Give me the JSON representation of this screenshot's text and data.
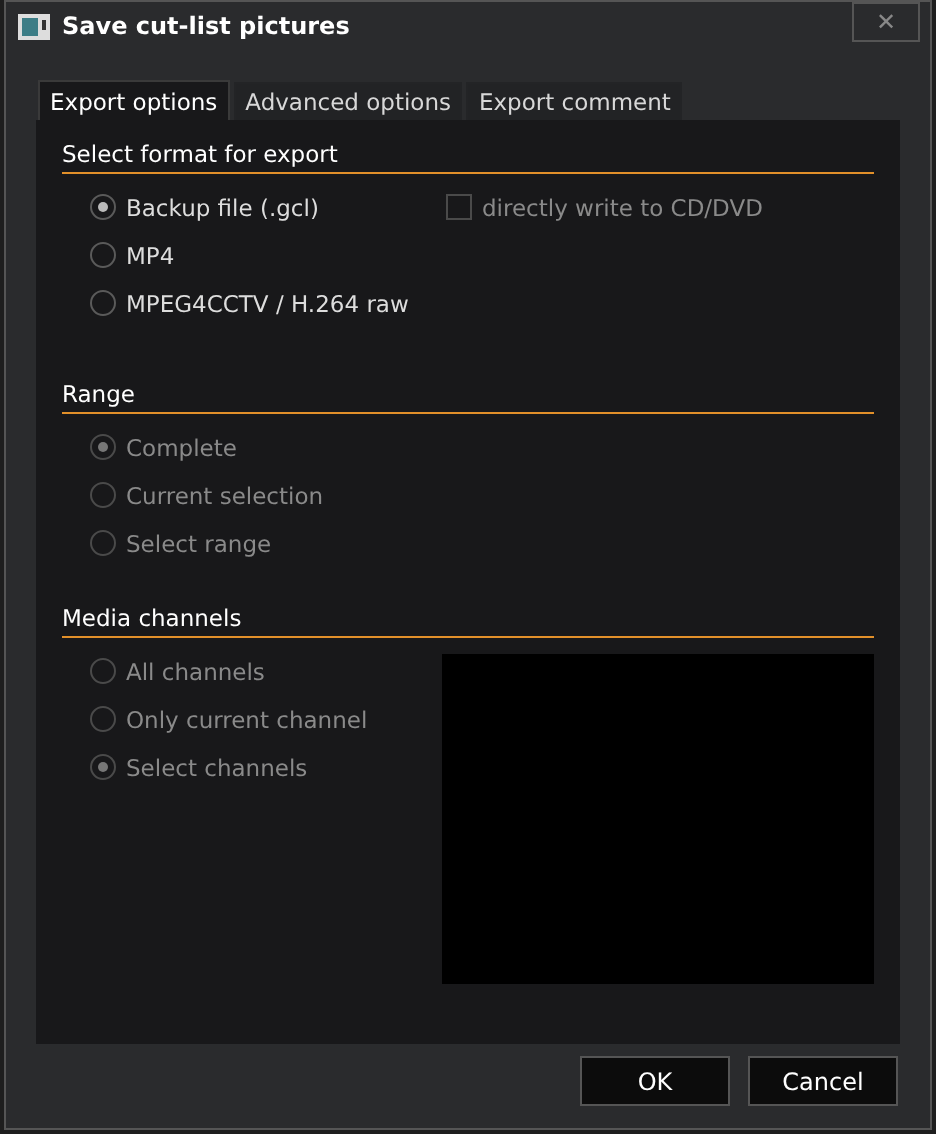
{
  "window": {
    "title": "Save cut-list pictures",
    "close": "✕"
  },
  "tabs": [
    {
      "label": "Export options",
      "selected": true
    },
    {
      "label": "Advanced options",
      "selected": false
    },
    {
      "label": "Export comment",
      "selected": false
    }
  ],
  "sections": [
    {
      "title": "Select format for export",
      "options": [
        {
          "label": "Backup file (.gcl)",
          "selected": true,
          "disabled": false
        },
        {
          "label": "MP4",
          "selected": false,
          "disabled": false
        },
        {
          "label": "MPEG4CCTV / H.264 raw",
          "selected": false,
          "disabled": false
        }
      ],
      "checkbox": {
        "label": "directly write to CD/DVD",
        "checked": false,
        "disabled": true
      }
    },
    {
      "title": "Range",
      "options": [
        {
          "label": "Complete",
          "selected": true,
          "disabled": true
        },
        {
          "label": "Current selection",
          "selected": false,
          "disabled": true
        },
        {
          "label": "Select range",
          "selected": false,
          "disabled": true
        }
      ]
    },
    {
      "title": "Media channels",
      "options": [
        {
          "label": "All channels",
          "selected": false,
          "disabled": true
        },
        {
          "label": "Only current channel",
          "selected": false,
          "disabled": true
        },
        {
          "label": "Select channels",
          "selected": true,
          "disabled": true
        }
      ],
      "channel_list": {
        "kind": "list"
      }
    }
  ],
  "buttons": [
    "OK",
    "Cancel"
  ]
}
